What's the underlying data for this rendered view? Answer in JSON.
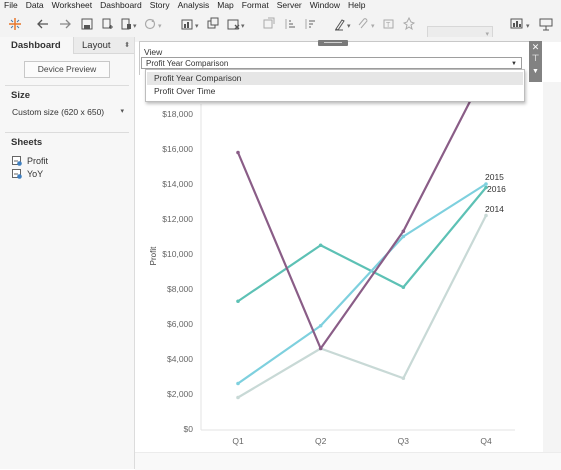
{
  "menu": [
    "File",
    "Data",
    "Worksheet",
    "Dashboard",
    "Story",
    "Analysis",
    "Map",
    "Format",
    "Server",
    "Window",
    "Help"
  ],
  "toolbar": {
    "icons": [
      "tableau-logo-icon",
      "undo-icon",
      "redo-icon",
      "save-icon",
      "new-datasource-icon",
      "pause-icon",
      "refresh-icon",
      "new-worksheet-icon",
      "duplicate-sheet-icon",
      "clear-sheet-icon",
      "swap-icon",
      "sort-ascending-icon",
      "sort-descending-icon",
      "highlight-icon",
      "paperclip-icon",
      "label-icon",
      "pin-icon",
      "fit-icon",
      "presentation-icon"
    ],
    "fit_value": ""
  },
  "sidebar": {
    "tab_dashboard": "Dashboard",
    "tab_layout": "Layout",
    "device_preview": "Device Preview",
    "size_title": "Size",
    "size_value": "Custom size (620 x 650)",
    "sheets_title": "Sheets",
    "sheets": [
      {
        "name": "Profit",
        "icon": "worksheet-icon"
      },
      {
        "name": "YoY",
        "icon": "worksheet-icon"
      }
    ]
  },
  "filter": {
    "title": "View",
    "selected": "Profit Year Comparison",
    "options": [
      "Profit Year Comparison",
      "Profit Over Time"
    ]
  },
  "chart_data": {
    "type": "line",
    "title": "",
    "xlabel": "",
    "ylabel": "Profit",
    "categories": [
      "Q1",
      "Q2",
      "Q3",
      "Q4"
    ],
    "ylim": [
      0,
      18000
    ],
    "yticks": [
      0,
      2000,
      4000,
      6000,
      8000,
      10000,
      12000,
      14000,
      16000,
      18000
    ],
    "ytick_labels": [
      "$0",
      "$2,000",
      "$4,000",
      "$6,000",
      "$8,000",
      "$10,000",
      "$12,000",
      "$14,000",
      "$16,000",
      "$18,000"
    ],
    "grid": false,
    "series": [
      {
        "name": "2014",
        "color": "#c8d9d6",
        "values": [
          1800,
          4600,
          2900,
          12200
        ]
      },
      {
        "name": "2016",
        "color": "#5dc1b5",
        "values": [
          7300,
          10500,
          8100,
          13800
        ]
      },
      {
        "name": "2015",
        "color": "#7ed0de",
        "values": [
          2600,
          5900,
          11000,
          14000
        ]
      },
      {
        "name": "",
        "color": "#8a5d87",
        "values": [
          15800,
          4600,
          11300,
          20500
        ]
      }
    ],
    "labels": [
      {
        "text": "2015",
        "series": 2
      },
      {
        "text": "2016",
        "series": 1
      },
      {
        "text": "2014",
        "series": 0
      }
    ]
  }
}
